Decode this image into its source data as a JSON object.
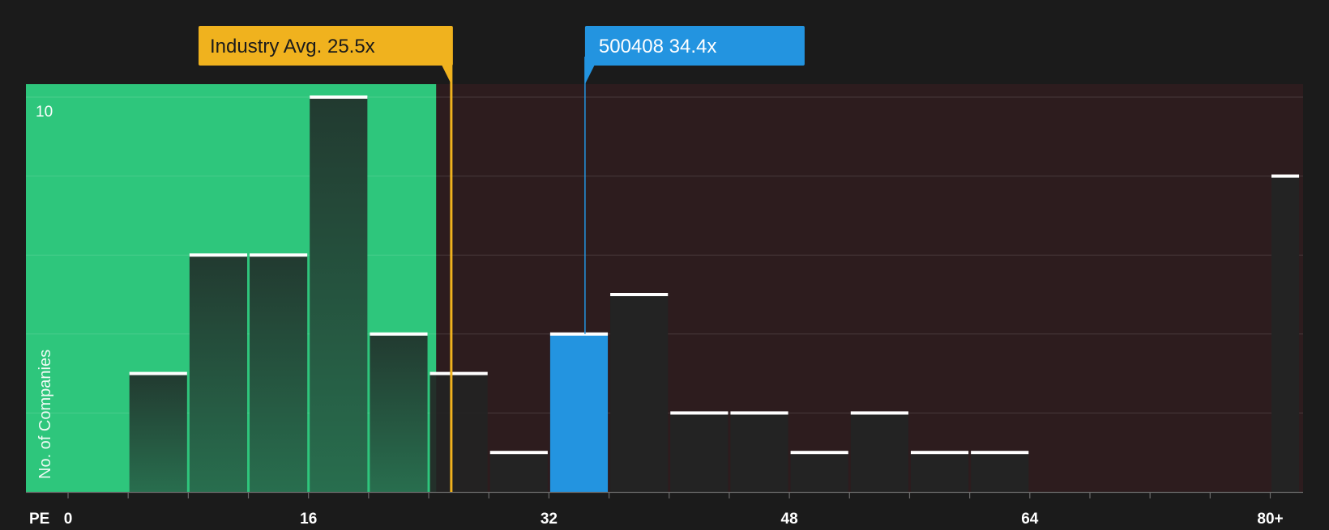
{
  "chart_data": {
    "type": "bar",
    "xlabel": "PE",
    "ylabel": "No. of Companies",
    "x_ticks": [
      "0",
      "16",
      "32",
      "48",
      "64",
      "80+"
    ],
    "y_ticks": [
      "10"
    ],
    "ylim": [
      0,
      10
    ],
    "bins": [
      {
        "x0": 4,
        "x1": 8,
        "value": 3
      },
      {
        "x0": 8,
        "x1": 12,
        "value": 6
      },
      {
        "x0": 12,
        "x1": 16,
        "value": 6
      },
      {
        "x0": 16,
        "x1": 20,
        "value": 10
      },
      {
        "x0": 20,
        "x1": 24,
        "value": 4
      },
      {
        "x0": 24,
        "x1": 28,
        "value": 3
      },
      {
        "x0": 28,
        "x1": 32,
        "value": 1
      },
      {
        "x0": 32,
        "x1": 36,
        "value": 4,
        "highlight": true
      },
      {
        "x0": 36,
        "x1": 40,
        "value": 5
      },
      {
        "x0": 40,
        "x1": 44,
        "value": 2
      },
      {
        "x0": 44,
        "x1": 48,
        "value": 2
      },
      {
        "x0": 48,
        "x1": 52,
        "value": 1
      },
      {
        "x0": 52,
        "x1": 56,
        "value": 2
      },
      {
        "x0": 56,
        "x1": 60,
        "value": 1
      },
      {
        "x0": 60,
        "x1": 64,
        "value": 1
      },
      {
        "x0": 80,
        "x1": 82,
        "value": 8
      }
    ],
    "markers": [
      {
        "name": "industry-avg",
        "label": "Industry Avg. 25.5x",
        "value": 25.5,
        "color": "#f0b21e"
      },
      {
        "name": "company",
        "label": "500408 34.4x",
        "value": 34.4,
        "color": "#2394e0"
      }
    ],
    "fair_region_end": 24.5,
    "colors": {
      "background": "#1b1b1b",
      "fair_region": "#2ec67c",
      "expensive_region": "#2d1c1e",
      "bar": "#232323",
      "highlight_bar": "#2394e0",
      "cap": "#ffffff",
      "industry": "#f0b21e",
      "company": "#2394e0"
    }
  }
}
